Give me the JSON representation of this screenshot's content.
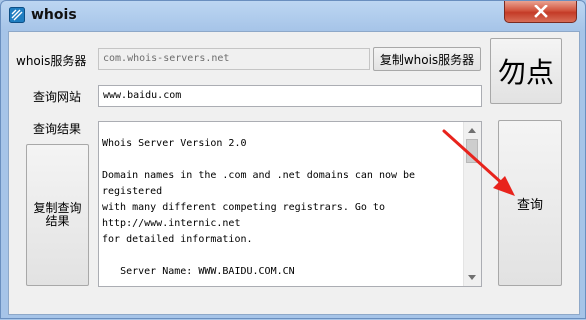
{
  "window": {
    "title": "whois",
    "app_icon": "whois-app-icon",
    "close_icon": "close-icon"
  },
  "form": {
    "server_label": "whois服务器",
    "server_value": "com.whois-servers.net",
    "copy_server_button": "复制whois服务器",
    "site_label": "查询网站",
    "site_value": "www.baidu.com",
    "result_label": "查询结果",
    "copy_result_button": "复制查询结果",
    "dont_click_button": "勿点",
    "query_button": "查询",
    "result_text": "Whois Server Version 2.0\n\nDomain names in the .com and .net domains can now be registered\nwith many different competing registrars. Go to http://www.internic.net\nfor detailed information.\n\n   Server Name: WWW.BAIDU.COM.CN"
  },
  "colors": {
    "annotation_arrow": "#e8231c",
    "title_close": "#c43b27"
  }
}
